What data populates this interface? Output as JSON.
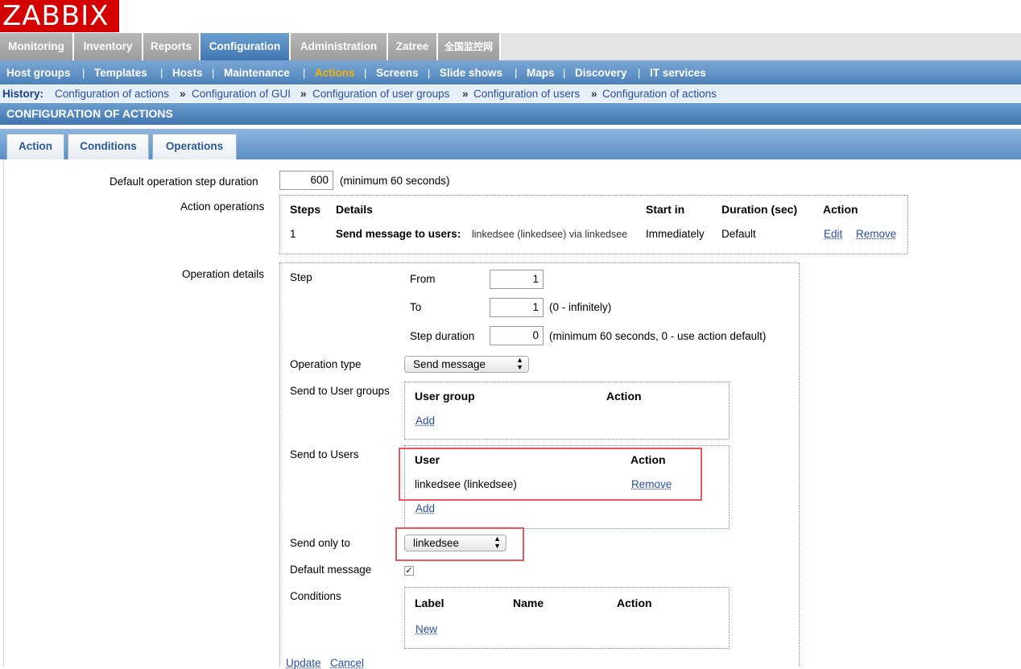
{
  "logo": "ZABBIX",
  "main_menu": [
    "Monitoring",
    "Inventory",
    "Reports",
    "Configuration",
    "Administration",
    "Zatree",
    "全国监控网"
  ],
  "sub_menu": [
    "Host groups",
    "Templates",
    "Hosts",
    "Maintenance",
    "Actions",
    "Screens",
    "Slide shows",
    "Maps",
    "Discovery",
    "IT services"
  ],
  "history": {
    "label": "History:",
    "links": [
      "Configuration of actions",
      "Configuration of GUI",
      "Configuration of user groups",
      "Configuration of users",
      "Configuration of actions"
    ],
    "separator": "»"
  },
  "page_title": "CONFIGURATION OF ACTIONS",
  "tabs": [
    "Action",
    "Conditions",
    "Operations"
  ],
  "form": {
    "default_step_duration_label": "Default operation step duration",
    "default_step_duration_value": "600",
    "default_step_duration_hint": "(minimum 60 seconds)",
    "action_operations_label": "Action operations",
    "operations_table": {
      "headers": [
        "Steps",
        "Details",
        "Start in",
        "Duration (sec)",
        "Action"
      ],
      "row": {
        "step": "1",
        "details_bold": "Send message to users:",
        "details_rest": "linkedsee (linkedsee) via linkedsee",
        "start_in": "Immediately",
        "duration": "Default",
        "edit": "Edit",
        "remove": "Remove"
      }
    },
    "operation_details_label": "Operation details",
    "step_label": "Step",
    "from_label": "From",
    "from_value": "1",
    "to_label": "To",
    "to_value": "1",
    "to_hint": "(0 - infinitely)",
    "step_duration_label": "Step duration",
    "step_duration_value": "0",
    "step_duration_hint": "(minimum 60 seconds, 0 - use action default)",
    "operation_type_label": "Operation type",
    "operation_type_value": "Send message",
    "send_to_groups_label": "Send to User groups",
    "groups_headers": [
      "User group",
      "Action"
    ],
    "groups_add": "Add",
    "send_to_users_label": "Send to Users",
    "users_headers": [
      "User",
      "Action"
    ],
    "users_row": {
      "user": "linkedsee (linkedsee)",
      "remove": "Remove"
    },
    "users_add": "Add",
    "send_only_to_label": "Send only to",
    "send_only_to_value": "linkedsee",
    "default_message_label": "Default message",
    "default_message_checked": "✓",
    "conditions_label": "Conditions",
    "conditions_headers": [
      "Label",
      "Name",
      "Action"
    ],
    "conditions_new": "New",
    "update": "Update",
    "cancel": "Cancel"
  },
  "colors": {
    "highlight": "#e8575a",
    "logo_bg": "#d40000",
    "active_submenu": "#f7b300"
  }
}
